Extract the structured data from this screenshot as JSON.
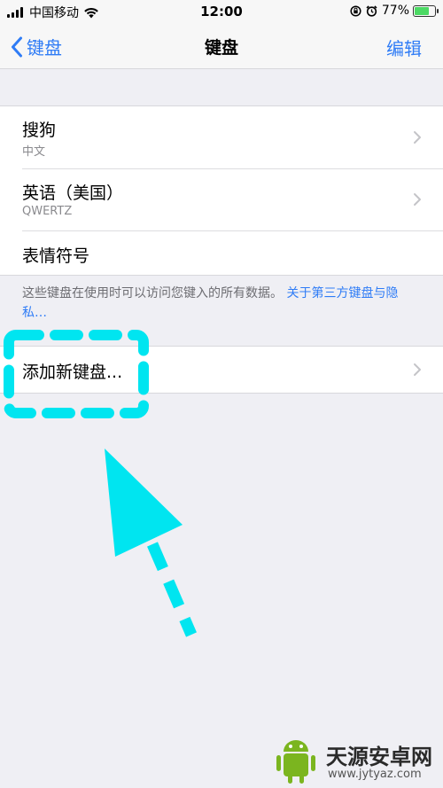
{
  "status_bar": {
    "carrier": "中国移动",
    "time": "12:00",
    "battery_text": "77%",
    "battery_level": 0.77,
    "icons": [
      "signal-icon",
      "wifi-icon",
      "orientation-lock-icon",
      "alarm-icon",
      "battery-icon"
    ]
  },
  "nav": {
    "back_label": "键盘",
    "title": "键盘",
    "edit_label": "编辑"
  },
  "keyboards": [
    {
      "title": "搜狗",
      "subtitle": "中文"
    },
    {
      "title": "英语（美国）",
      "subtitle": "QWERTZ"
    },
    {
      "title": "表情符号",
      "subtitle": ""
    }
  ],
  "footer": {
    "text": "这些键盘在使用时可以访问您键入的所有数据。",
    "link": "关于第三方键盘与隐私…"
  },
  "add_keyboard": {
    "label": "添加新键盘..."
  },
  "watermark": {
    "cn": "天源安卓网",
    "url": "www.jytyaz.com"
  },
  "colors": {
    "accent": "#2f7cf6",
    "annotation": "#00e5f0",
    "background": "#efeff4"
  }
}
